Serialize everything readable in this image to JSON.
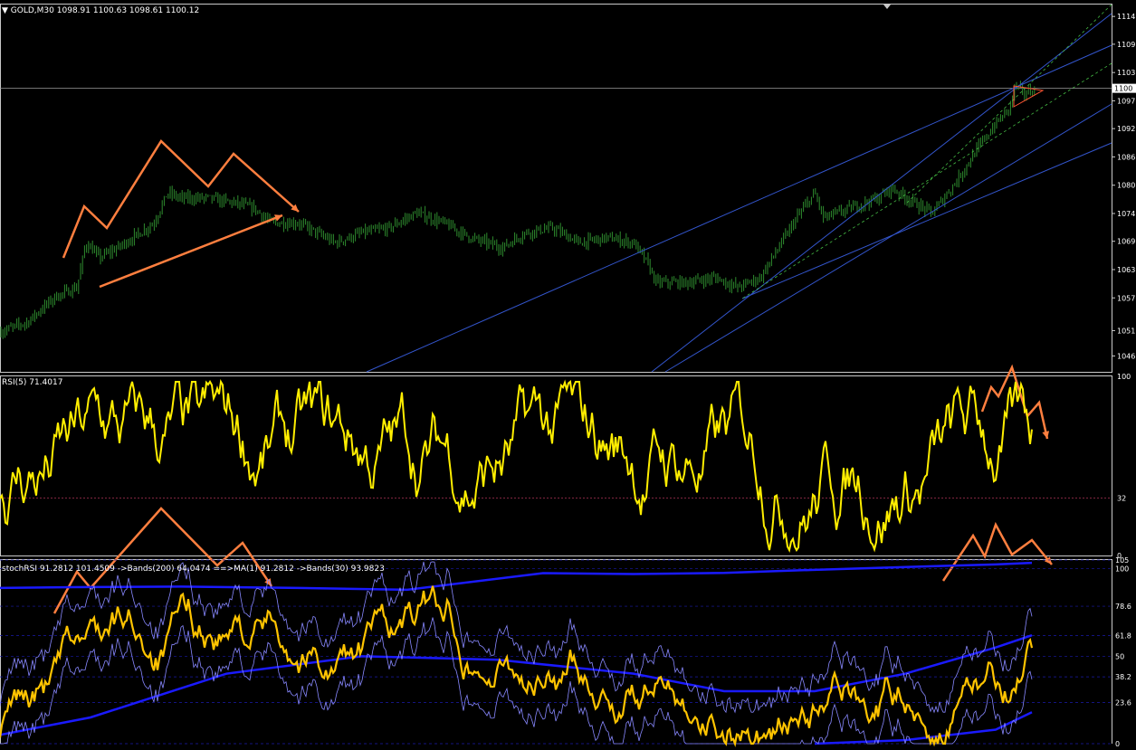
{
  "chart_data": [
    {
      "type": "candlestick",
      "title": "GOLD,M30",
      "ohlc_header": "1098.91 1100.63 1098.61 1100.12",
      "series_color": "#2e8b2e",
      "price_line_label": "1100",
      "ylim": [
        1043,
        1117
      ],
      "y_ticks": [
        "1114",
        "1109",
        "1103",
        "1097",
        "1092",
        "1086",
        "1080",
        "1074",
        "1069",
        "1063",
        "1057",
        "1051",
        "1046"
      ],
      "y_tick_values": [
        1114.6,
        1109,
        1103.3,
        1097.6,
        1092,
        1086.3,
        1080.6,
        1074.9,
        1069.3,
        1063.6,
        1057.9,
        1051.3,
        1046.2
      ],
      "current_price": 1100.12,
      "close_path": [
        [
          0,
          1051
        ],
        [
          30,
          1053
        ],
        [
          60,
          1058
        ],
        [
          85,
          1060
        ],
        [
          95,
          1069
        ],
        [
          110,
          1066
        ],
        [
          130,
          1068
        ],
        [
          155,
          1071
        ],
        [
          170,
          1073
        ],
        [
          185,
          1079
        ],
        [
          200,
          1078
        ],
        [
          230,
          1078
        ],
        [
          260,
          1077
        ],
        [
          280,
          1076
        ],
        [
          300,
          1073
        ],
        [
          330,
          1073
        ],
        [
          350,
          1071
        ],
        [
          370,
          1069
        ],
        [
          400,
          1071
        ],
        [
          430,
          1072
        ],
        [
          460,
          1075
        ],
        [
          490,
          1073
        ],
        [
          520,
          1070
        ],
        [
          555,
          1068
        ],
        [
          580,
          1071
        ],
        [
          610,
          1072
        ],
        [
          640,
          1069
        ],
        [
          670,
          1070
        ],
        [
          700,
          1069
        ],
        [
          715,
          1065
        ],
        [
          725,
          1061
        ],
        [
          760,
          1061
        ],
        [
          790,
          1062
        ],
        [
          815,
          1060
        ],
        [
          840,
          1062
        ],
        [
          860,
          1068
        ],
        [
          880,
          1074
        ],
        [
          900,
          1079
        ],
        [
          910,
          1074
        ],
        [
          940,
          1076
        ],
        [
          970,
          1078
        ],
        [
          985,
          1080
        ],
        [
          1010,
          1077
        ],
        [
          1030,
          1075
        ],
        [
          1055,
          1081
        ],
        [
          1080,
          1088
        ],
        [
          1100,
          1093
        ],
        [
          1115,
          1096
        ],
        [
          1122,
          1101
        ],
        [
          1130,
          1099
        ],
        [
          1145,
          1100
        ]
      ],
      "trendlines_color": "#3355cc",
      "annotation_color": "#ff7f3f"
    },
    {
      "type": "line",
      "title": "RSI(5) 71.4017",
      "series": [
        {
          "name": "RSI(5)",
          "color": "#ffee00"
        }
      ],
      "ylim": [
        0,
        100
      ],
      "y_ticks": [
        "100",
        "32",
        "0"
      ],
      "y_tick_values": [
        100,
        32,
        0
      ],
      "level_line": 32
    },
    {
      "type": "line",
      "title": "stochRSI 91.2812 101.4509 ->Bands(200) 64.0474 ==>MA(1) 91.2812 ->Bands(30) 93.9823",
      "series": [
        {
          "name": "stochRSI",
          "color": "#ffc400"
        },
        {
          "name": "->Bands(200)",
          "color": "#1a1aff"
        },
        {
          "name": "->Bands(30)",
          "color": "#8888ff"
        }
      ],
      "ylim": [
        0,
        105
      ],
      "y_ticks": [
        "105",
        "100",
        "78.6",
        "61.8",
        "50",
        "38.2",
        "23.6",
        "0"
      ],
      "y_tick_values": [
        105,
        100,
        78.6,
        61.8,
        50,
        38.2,
        23.6,
        0
      ]
    }
  ]
}
